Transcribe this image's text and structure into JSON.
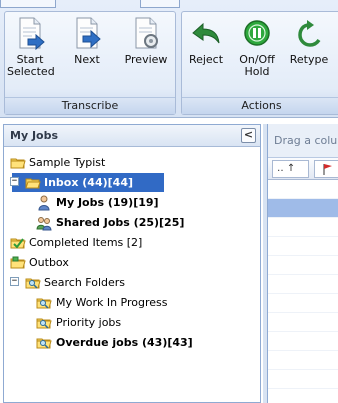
{
  "ribbon": {
    "groups": [
      {
        "label": "Transcribe",
        "buttons": [
          {
            "label": "Start\nSelected",
            "icon": "start-selected-document-icon"
          },
          {
            "label": "Next",
            "icon": "next-document-icon"
          },
          {
            "label": "Preview",
            "icon": "preview-document-icon"
          }
        ]
      },
      {
        "label": "Actions",
        "buttons": [
          {
            "label": "Reject",
            "icon": "reject-arrow-icon"
          },
          {
            "label": "On/Off\nHold",
            "icon": "pause-hold-icon"
          },
          {
            "label": "Retype",
            "icon": "retype-arrow-icon"
          }
        ]
      }
    ]
  },
  "left_pane": {
    "title": "My Jobs",
    "collapse_glyph": "<",
    "tree": [
      {
        "label": "Sample Typist",
        "icon": "folder-icon",
        "depth": 0,
        "expander": ""
      },
      {
        "label": "Inbox (44)[44]",
        "icon": "folder-open-icon",
        "depth": 0,
        "expander": "−",
        "bold": true,
        "selected": true
      },
      {
        "label": "My Jobs (19)[19]",
        "icon": "user-icon",
        "depth": 1,
        "expander": "",
        "bold": true
      },
      {
        "label": "Shared Jobs (25)[25]",
        "icon": "users-icon",
        "depth": 1,
        "expander": "",
        "bold": true
      },
      {
        "label": "Completed Items [2]",
        "icon": "completed-folder-icon",
        "depth": 0,
        "expander": ""
      },
      {
        "label": "Outbox",
        "icon": "outbox-folder-icon",
        "depth": 0,
        "expander": ""
      },
      {
        "label": "Search Folders",
        "icon": "search-folder-icon",
        "depth": 0,
        "expander": "−"
      },
      {
        "label": "My Work In Progress",
        "icon": "search-folder-icon",
        "depth": 1,
        "expander": ""
      },
      {
        "label": "Priority jobs",
        "icon": "search-folder-icon",
        "depth": 1,
        "expander": ""
      },
      {
        "label": "Overdue jobs (43)[43]",
        "icon": "search-folder-icon",
        "depth": 1,
        "expander": "",
        "bold": true
      }
    ]
  },
  "right_pane": {
    "drag_hint": "Drag a colu",
    "column_1": "‥ ↑"
  },
  "colors": {
    "selection": "#316ac5",
    "ribbon_bg": "#dbe6f5",
    "pane_border": "#8faad2"
  }
}
